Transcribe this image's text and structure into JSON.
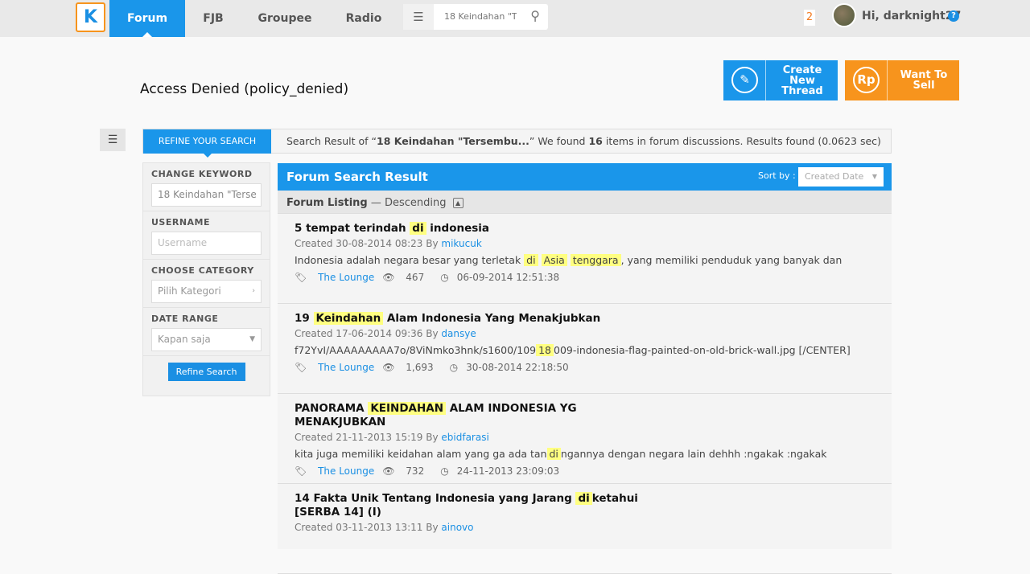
{
  "nav": {
    "logo": "K",
    "tabs": [
      "Forum",
      "FJB",
      "Groupee",
      "Radio"
    ],
    "search_value": "18 Keindahan \"T",
    "notif_count": "2",
    "greeting": "Hi, darknight27"
  },
  "page_title": "Access Denied (policy_denied)",
  "actions": {
    "create": "Create New Thread",
    "sell": "Want To Sell",
    "sell_icon_text": "Rp"
  },
  "refine": {
    "tab": "REFINE YOUR SEARCH",
    "info_pre": "Search Result of “",
    "query": "18 Keindahan \"Tersembu...",
    "info_mid": "” We found ",
    "count": "16",
    "info_post": " items in forum discussions. Results found (0.0623 sec)"
  },
  "sidebar": {
    "keyword_label": "CHANGE KEYWORD",
    "keyword_value": "18 Keindahan \"Terse",
    "username_label": "USERNAME",
    "username_placeholder": "Username",
    "category_label": "CHOOSE CATEGORY",
    "category_value": "Pilih Kategori",
    "date_label": "DATE RANGE",
    "date_value": "Kapan saja",
    "button": "Refine Search"
  },
  "results": {
    "title": "Forum Search Result",
    "sort_label": "Sort by :",
    "sort_value": "Created Date",
    "listing": "Forum Listing",
    "order": " — Descending",
    "items": [
      {
        "title": [
          {
            "t": "5 tempat terindah "
          },
          {
            "t": "di",
            "hl": true
          },
          {
            "t": " indonesia"
          }
        ],
        "created": "Created 30-08-2014 08:23 By ",
        "author": "mikucuk",
        "snippet": [
          {
            "t": "Indonesia adalah negara besar yang terletak "
          },
          {
            "t": "di",
            "hl": true
          },
          {
            "t": " "
          },
          {
            "t": "Asia",
            "hl": true
          },
          {
            "t": " "
          },
          {
            "t": "tenggara",
            "hl": true
          },
          {
            "t": ", yang memiliki penduduk yang banyak dan"
          }
        ],
        "forum": "The Lounge",
        "views": "467",
        "last": "06-09-2014 12:51:38"
      },
      {
        "title": [
          {
            "t": "19 "
          },
          {
            "t": "Keindahan",
            "hl": true
          },
          {
            "t": " Alam Indonesia Yang Menakjubkan"
          }
        ],
        "created": "Created 17-06-2014 09:36 By ",
        "author": "dansye",
        "snippet": [
          {
            "t": "f72YvI/AAAAAAAAA7o/8ViNmko3hnk/s1600/109"
          },
          {
            "t": "18",
            "hl": true
          },
          {
            "t": "009-indonesia-flag-painted-on-old-brick-wall.jpg [/CENTER]"
          }
        ],
        "forum": "The Lounge",
        "views": "1,693",
        "last": "30-08-2014 22:18:50"
      },
      {
        "title": [
          {
            "t": "PANORAMA "
          },
          {
            "t": "KEINDAHAN",
            "hl": true
          },
          {
            "t": " ALAM INDONESIA YG MENAKJUBKAN"
          }
        ],
        "created": "Created 21-11-2013 15:19 By ",
        "author": "ebidfarasi",
        "snippet": [
          {
            "t": "kita juga memiliki keidahan alam yang ga ada tan"
          },
          {
            "t": "di",
            "hl": true
          },
          {
            "t": "ngannya dengan negara lain dehhh :ngakak :ngakak"
          }
        ],
        "forum": "The Lounge",
        "views": "732",
        "last": "24-11-2013 23:09:03"
      },
      {
        "title": [
          {
            "t": "14 Fakta Unik Tentang Indonesia yang Jarang "
          },
          {
            "t": "di",
            "hl": true
          },
          {
            "t": "ketahui [SERBA 14] (I)"
          }
        ],
        "created": "Created 03-11-2013 13:11 By ",
        "author": "ainovo",
        "snippet": [],
        "forum": "",
        "views": "",
        "last": ""
      }
    ]
  },
  "colors": {
    "blue": "#1a96ea",
    "orange": "#f7941d",
    "highlight": "#ffff80"
  }
}
